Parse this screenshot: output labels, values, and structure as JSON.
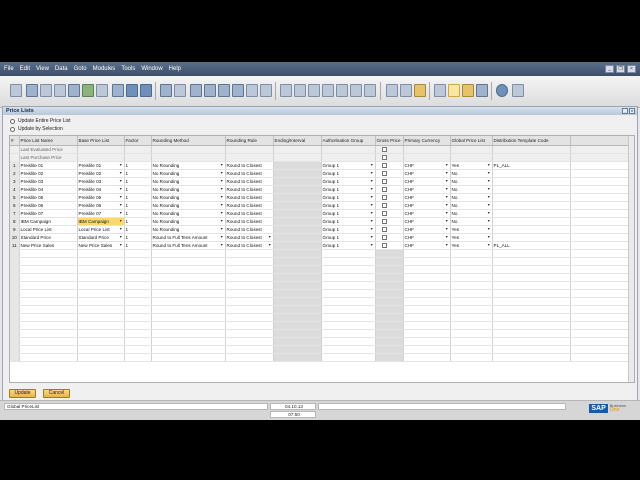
{
  "menu": [
    "File",
    "Edit",
    "View",
    "Data",
    "Goto",
    "Modules",
    "Tools",
    "Window",
    "Help"
  ],
  "window": {
    "title": "Price Lists"
  },
  "options": {
    "update_entire": "Update Entire Price List",
    "update_selection": "Update by Selection"
  },
  "columns": [
    "#",
    "Price List Name",
    "Base Price List",
    "Factor",
    "Rounding Method",
    "Rounding Rule",
    "Ending/Interval",
    "Authorisation Group",
    "Gross Price",
    "Primary Currency",
    "Global Price List",
    "Distribution Template Code"
  ],
  "pre_rows": [
    "Last Evaluated Price",
    "Last Purchase Price"
  ],
  "rows": [
    {
      "n": "1",
      "name": "Preislite 01",
      "base": "Preislite 01",
      "factor": "1",
      "method": "No Rounding",
      "rule": "Round to Closest",
      "auth": "Group 1",
      "cur": "CHF",
      "global": "Yes",
      "dist": "PL_ALL"
    },
    {
      "n": "2",
      "name": "Preislite 02",
      "base": "Preislite 02",
      "factor": "1",
      "method": "No Rounding",
      "rule": "Round to Closest",
      "auth": "Group 1",
      "cur": "CHF",
      "global": "No",
      "dist": ""
    },
    {
      "n": "3",
      "name": "Preislite 03",
      "base": "Preislite 03",
      "factor": "1",
      "method": "No Rounding",
      "rule": "Round to Closest",
      "auth": "Group 1",
      "cur": "CHF",
      "global": "No",
      "dist": ""
    },
    {
      "n": "4",
      "name": "Preislite 04",
      "base": "Preislite 04",
      "factor": "1",
      "method": "No Rounding",
      "rule": "Round to Closest",
      "auth": "Group 1",
      "cur": "CHF",
      "global": "No",
      "dist": ""
    },
    {
      "n": "5",
      "name": "Preislite 05",
      "base": "Preislite 05",
      "factor": "1",
      "method": "No Rounding",
      "rule": "Round to Closest",
      "auth": "Group 1",
      "cur": "CHF",
      "global": "No",
      "dist": ""
    },
    {
      "n": "6",
      "name": "Preislite 06",
      "base": "Preislite 06",
      "factor": "1",
      "method": "No Rounding",
      "rule": "Round to Closest",
      "auth": "Group 1",
      "cur": "CHF",
      "global": "No",
      "dist": ""
    },
    {
      "n": "7",
      "name": "Preislite 07",
      "base": "Preislite 07",
      "factor": "1",
      "method": "No Rounding",
      "rule": "Round to Closest",
      "auth": "Group 1",
      "cur": "CHF",
      "global": "No",
      "dist": ""
    },
    {
      "n": "8",
      "name": "IBM Campaign",
      "base": "IBM Campaign",
      "factor": "1",
      "method": "No Rounding",
      "rule": "Round to Closest",
      "auth": "Group 1",
      "cur": "CHF",
      "global": "No",
      "dist": ""
    },
    {
      "n": "9",
      "name": "Local Price List",
      "base": "Local Price List",
      "factor": "1",
      "method": "No Rounding",
      "rule": "Round to Closest",
      "auth": "Group 1",
      "cur": "CHF",
      "global": "Yes",
      "dist": ""
    },
    {
      "n": "10",
      "name": "Standard Price",
      "base": "Standard Price",
      "factor": "1",
      "method": "Round to Full Tens Amount",
      "rule": "Round to Closest",
      "auth": "Group 1",
      "cur": "CHF",
      "global": "Yes",
      "dist": ""
    },
    {
      "n": "11",
      "name": "New Price Sales",
      "base": "New Price Sales",
      "factor": "1",
      "method": "Round to Full Tens Amount",
      "rule": "Round to Closest",
      "auth": "Group 1",
      "cur": "CHF",
      "global": "Yes",
      "dist": "PL_ALL"
    }
  ],
  "buttons": {
    "update": "Update",
    "cancel": "Cancel"
  },
  "status": {
    "left": "Global PriceList",
    "date": "04.10.13",
    "time": "07:50"
  },
  "logo": {
    "sap": "SAP",
    "business": "Business",
    "one": "One"
  }
}
